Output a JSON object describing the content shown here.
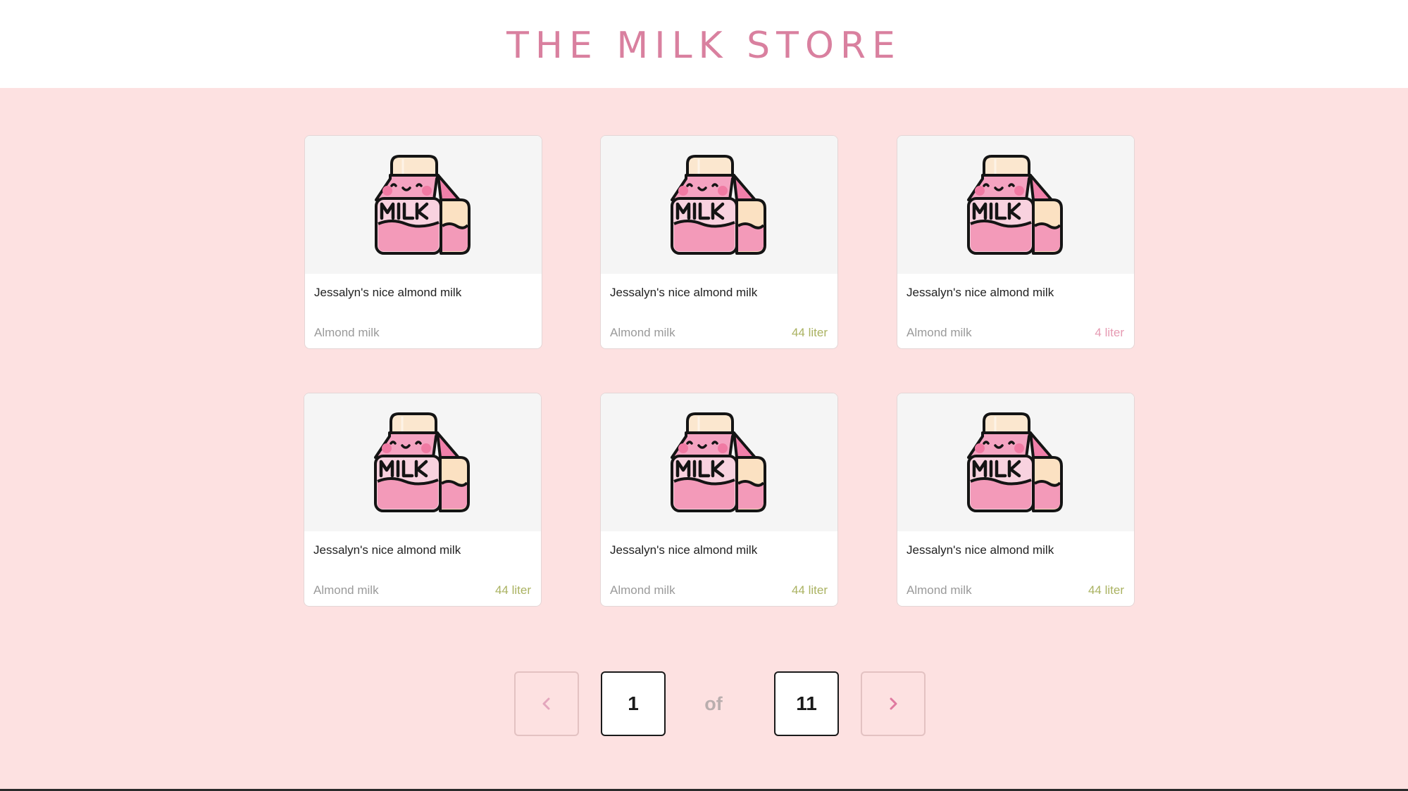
{
  "header": {
    "title": "THE MILK STORE"
  },
  "colors": {
    "background": "#fde1e1",
    "title": "#d9809f",
    "volume_green": "#aab261",
    "volume_pink": "#e69ab2"
  },
  "products": [
    {
      "name": "Jessalyn's nice almond milk",
      "category": "Almond milk",
      "volume": "",
      "icon": "milk-carton-icon"
    },
    {
      "name": "Jessalyn's nice almond milk",
      "category": "Almond milk",
      "volume": "44 liter",
      "icon": "milk-carton-icon"
    },
    {
      "name": "Jessalyn's nice almond milk",
      "category": "Almond milk",
      "volume": "4 liter",
      "icon": "milk-carton-icon"
    },
    {
      "name": "Jessalyn's nice almond milk",
      "category": "Almond milk",
      "volume": "44 liter",
      "icon": "milk-carton-icon"
    },
    {
      "name": "Jessalyn's nice almond milk",
      "category": "Almond milk",
      "volume": "44 liter",
      "icon": "milk-carton-icon"
    },
    {
      "name": "Jessalyn's nice almond milk",
      "category": "Almond milk",
      "volume": "44 liter",
      "icon": "milk-carton-icon"
    }
  ],
  "pagination": {
    "current_page": "1",
    "of_label": "of",
    "total_pages": "11",
    "prev_icon": "chevron-left-icon",
    "next_icon": "chevron-right-icon"
  }
}
